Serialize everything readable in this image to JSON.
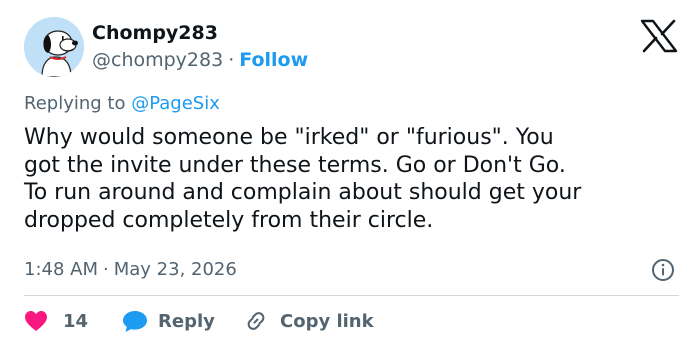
{
  "author": {
    "display_name": "Chompy283",
    "handle": "@chompy283",
    "separator": "·",
    "follow_label": "Follow"
  },
  "reply_context": {
    "prefix": "Replying to",
    "mention": "@PageSix"
  },
  "tweet": {
    "lines": [
      "Why would someone be \"irked\" or \"furious\".  You",
      "got the invite under these terms.  Go or Don't Go.",
      "To run around and complain about should get your",
      "dropped completely from their circle."
    ],
    "time": "1:48 AM",
    "separator": "·",
    "date": "May 23, 2026"
  },
  "actions": {
    "like_count": "14",
    "reply_label": "Reply",
    "copy_link_label": "Copy link"
  },
  "colors": {
    "accent": "#1d9bf0",
    "like": "#f91880",
    "secondary_text": "#536471",
    "divider": "#cfd9de"
  },
  "icons": {
    "brand": "x-logo-icon",
    "info": "info-icon",
    "like": "heart-icon",
    "reply": "speech-bubble-icon",
    "copy_link": "link-icon"
  }
}
